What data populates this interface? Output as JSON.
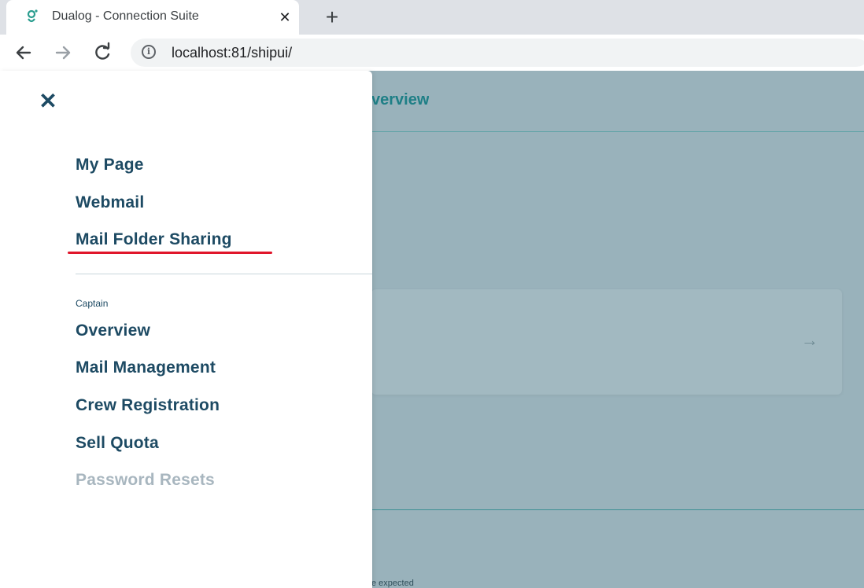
{
  "browser": {
    "tab_title": "Dualog - Connection Suite",
    "favicon_icon": "dualog-logo-icon",
    "close_symbol": "✕",
    "new_tab_symbol": "+",
    "url": "localhost:81/shipui/"
  },
  "page": {
    "heading": "verview",
    "card_arrow": "→",
    "footnote": "e expected"
  },
  "drawer": {
    "close_symbol": "✕",
    "primary_items": [
      {
        "label": "My Page"
      },
      {
        "label": "Webmail"
      },
      {
        "label": "Mail Folder Sharing",
        "highlighted": true
      }
    ],
    "section_label": "Captain",
    "captain_items": [
      {
        "label": "Overview"
      },
      {
        "label": "Mail Management"
      },
      {
        "label": "Crew Registration"
      },
      {
        "label": "Sell Quota"
      },
      {
        "label": "Password Resets",
        "disabled": true
      }
    ]
  },
  "colors": {
    "drawer_text": "#1d4a63",
    "disabled_text": "#a8b6bf",
    "highlight_underline": "#e0162b",
    "overlay_background": "#99b2bb",
    "accent": "#1e7f86"
  }
}
